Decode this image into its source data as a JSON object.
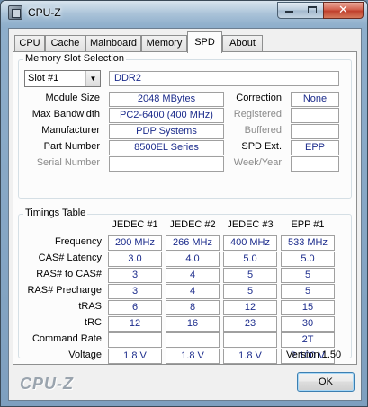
{
  "window": {
    "title": "CPU-Z"
  },
  "tabs": [
    "CPU",
    "Cache",
    "Mainboard",
    "Memory",
    "SPD",
    "About"
  ],
  "active_tab": "SPD",
  "memory_slot": {
    "group_title": "Memory Slot Selection",
    "slot_selected": "Slot #1",
    "module_type": "DDR2",
    "labels": {
      "module_size": "Module Size",
      "max_bandwidth": "Max Bandwidth",
      "manufacturer": "Manufacturer",
      "part_number": "Part Number",
      "serial_number": "Serial Number",
      "correction": "Correction",
      "registered": "Registered",
      "buffered": "Buffered",
      "spd_ext": "SPD Ext.",
      "week_year": "Week/Year"
    },
    "values": {
      "module_size": "2048 MBytes",
      "max_bandwidth": "PC2-6400 (400 MHz)",
      "manufacturer": "PDP Systems",
      "part_number": "8500EL Series",
      "serial_number": "",
      "correction": "None",
      "registered": "",
      "buffered": "",
      "spd_ext": "EPP",
      "week_year": ""
    }
  },
  "timings": {
    "group_title": "Timings Table",
    "columns": [
      "JEDEC #1",
      "JEDEC #2",
      "JEDEC #3",
      "EPP #1"
    ],
    "rows": [
      {
        "label": "Frequency",
        "values": [
          "200 MHz",
          "266 MHz",
          "400 MHz",
          "533 MHz"
        ]
      },
      {
        "label": "CAS# Latency",
        "values": [
          "3.0",
          "4.0",
          "5.0",
          "5.0"
        ]
      },
      {
        "label": "RAS# to CAS#",
        "values": [
          "3",
          "4",
          "5",
          "5"
        ]
      },
      {
        "label": "RAS# Precharge",
        "values": [
          "3",
          "4",
          "5",
          "5"
        ]
      },
      {
        "label": "tRAS",
        "values": [
          "6",
          "8",
          "12",
          "15"
        ]
      },
      {
        "label": "tRC",
        "values": [
          "12",
          "16",
          "23",
          "30"
        ]
      },
      {
        "label": "Command Rate",
        "values": [
          "",
          "",
          "",
          "2T"
        ]
      },
      {
        "label": "Voltage",
        "values": [
          "1.8 V",
          "1.8 V",
          "1.8 V",
          "2.100 V"
        ]
      }
    ]
  },
  "footer": {
    "version": "Version 1.50",
    "brand": "CPU-Z",
    "ok_label": "OK"
  }
}
